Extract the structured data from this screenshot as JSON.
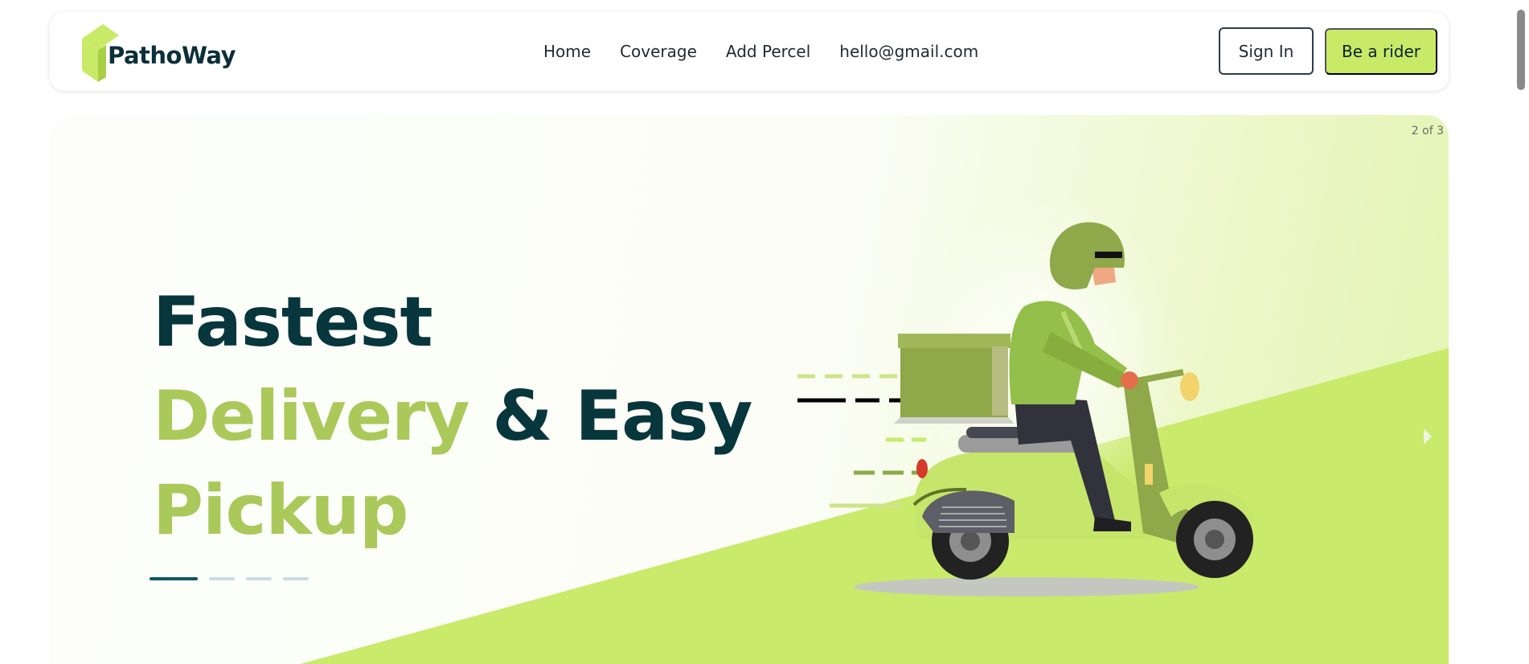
{
  "brand": {
    "name": "PathoWay",
    "accent_color": "#c9ea67",
    "dark_color": "#07363c",
    "green_text_color": "#aac95a"
  },
  "nav": {
    "links": [
      {
        "label": "Home"
      },
      {
        "label": "Coverage"
      },
      {
        "label": "Add Percel"
      },
      {
        "label": "hello@gmail.com"
      }
    ],
    "sign_in_label": "Sign In",
    "rider_label": "Be a rider"
  },
  "hero": {
    "slide_counter": "2 of 3",
    "headline_line1": "Fastest",
    "headline_line2_green": "Delivery",
    "headline_line2_dark": "& Easy",
    "headline_line3": "Pickup",
    "illustration": "delivery-rider-on-scooter",
    "slide_indicators": 4,
    "active_indicator": 1
  }
}
